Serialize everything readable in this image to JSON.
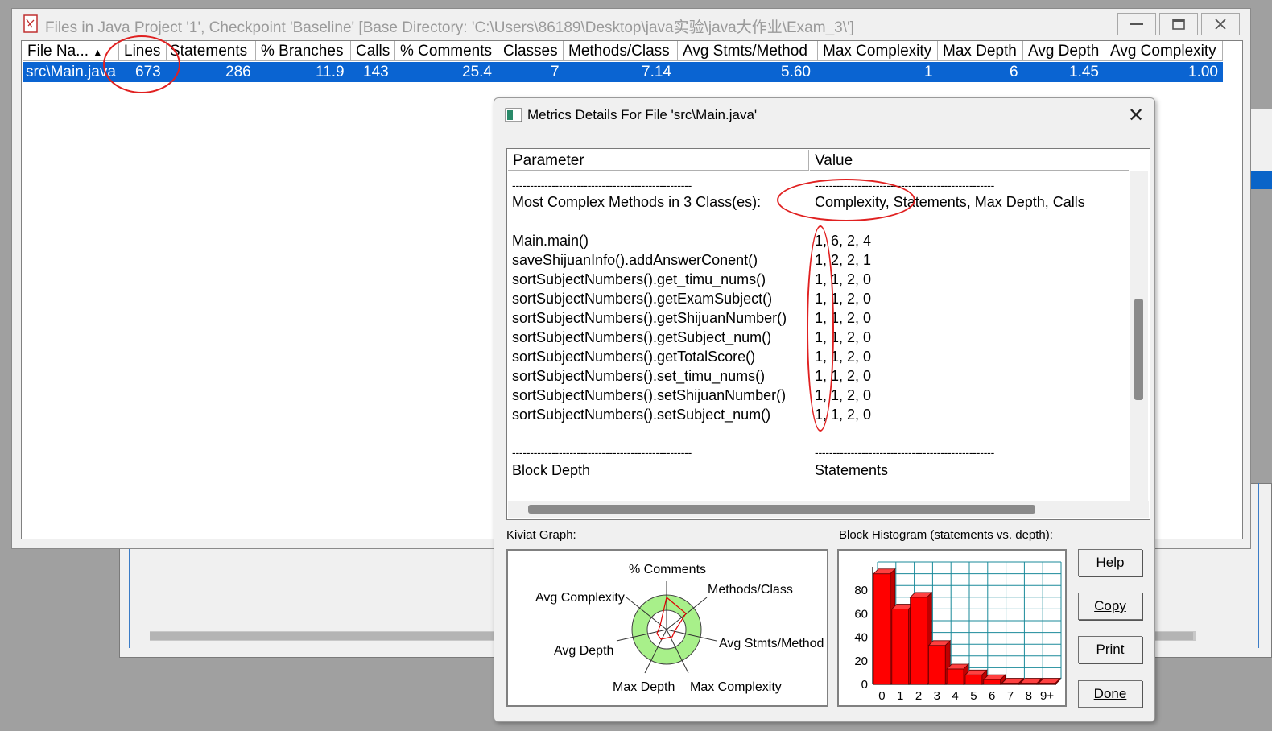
{
  "main_window": {
    "title": "Files in Java Project '1', Checkpoint 'Baseline'  [Base Directory: 'C:\\Users\\86189\\Desktop\\java实验\\java大作业\\Exam_3\\']",
    "columns": [
      "File Na...",
      "Lines",
      "Statements",
      "% Branches",
      "Calls",
      "% Comments",
      "Classes",
      "Methods/Class",
      "Avg Stmts/Method",
      "Max Complexity",
      "Max Depth",
      "Avg Depth",
      "Avg Complexity"
    ],
    "sort_indicator": "▲",
    "row": [
      "src\\Main.java",
      "673",
      "286",
      "11.9",
      "143",
      "25.4",
      "7",
      "7.14",
      "5.60",
      "1",
      "6",
      "1.45",
      "1.00"
    ]
  },
  "dialog": {
    "title": "Metrics Details For File 'src\\Main.java'",
    "close": "✕",
    "header_parameter": "Parameter",
    "header_value": "Value",
    "dashes_left": "--------------------------------------------------",
    "dashes_right": "--------------------------------------------------",
    "most_complex_label": "Most Complex Methods in 3 Class(es):",
    "most_complex_value": "Complexity, Statements, Max Depth, Calls",
    "methods": [
      {
        "name": "Main.main()",
        "value": "1, 6, 2, 4"
      },
      {
        "name": "saveShijuanInfo().addAnswerConent()",
        "value": "1, 2, 2, 1"
      },
      {
        "name": "sortSubjectNumbers().get_timu_nums()",
        "value": "1, 1, 2, 0"
      },
      {
        "name": "sortSubjectNumbers().getExamSubject()",
        "value": "1, 1, 2, 0"
      },
      {
        "name": "sortSubjectNumbers().getShijuanNumber()",
        "value": "1, 1, 2, 0"
      },
      {
        "name": "sortSubjectNumbers().getSubject_num()",
        "value": "1, 1, 2, 0"
      },
      {
        "name": "sortSubjectNumbers().getTotalScore()",
        "value": "1, 1, 2, 0"
      },
      {
        "name": "sortSubjectNumbers().set_timu_nums()",
        "value": "1, 1, 2, 0"
      },
      {
        "name": "sortSubjectNumbers().setShijuanNumber()",
        "value": "1, 1, 2, 0"
      },
      {
        "name": "sortSubjectNumbers().setSubject_num()",
        "value": "1, 1, 2, 0"
      }
    ],
    "block_depth_label": "Block Depth",
    "block_depth_value": "Statements",
    "kiviat_label": "Kiviat Graph:",
    "histogram_label": "Block Histogram (statements vs. depth):",
    "kiviat_axes": [
      "% Comments",
      "Methods/Class",
      "Avg Stmts/Method",
      "Max Complexity",
      "Max Depth",
      "Avg Depth",
      "Avg Complexity"
    ],
    "buttons": {
      "help": "Help",
      "copy": "Copy",
      "print": "Print",
      "done": "Done"
    }
  },
  "chart_data": {
    "type": "bar",
    "categories": [
      "0",
      "1",
      "2",
      "3",
      "4",
      "5",
      "6",
      "7",
      "8",
      "9+"
    ],
    "values": [
      94,
      64,
      74,
      33,
      13,
      8,
      4,
      1,
      1,
      1
    ],
    "yticks": [
      "0",
      "20",
      "40",
      "60",
      "80"
    ],
    "ylim": [
      0,
      100
    ],
    "color": "#ff0000"
  }
}
